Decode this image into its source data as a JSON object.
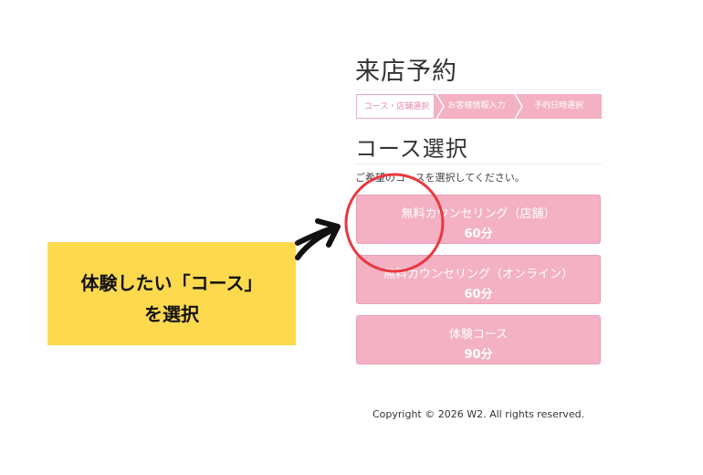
{
  "page": {
    "title": "来店予約"
  },
  "steps": [
    {
      "label": "コース・店舗選択",
      "active": true
    },
    {
      "label": "お客様情報入力",
      "active": false
    },
    {
      "label": "予約日時選択",
      "active": false
    }
  ],
  "section": {
    "title": "コース選択",
    "instruction": "ご希望のコースを選択してください。"
  },
  "courses": [
    {
      "name": "無料カウンセリング（店舗）",
      "duration": "60分"
    },
    {
      "name": "無料カウンセリング（オンライン）",
      "duration": "60分"
    },
    {
      "name": "体験コース",
      "duration": "90分"
    }
  ],
  "footer": {
    "copyright": "Copyright © 2026 W2. All rights reserved."
  },
  "annotation": {
    "line1": "体験したい「コース」",
    "line2": "を選択"
  },
  "colors": {
    "accent_pink": "#f3b1c3",
    "highlight_circle": "#e8383d",
    "callout_bg": "#fdd94e"
  }
}
